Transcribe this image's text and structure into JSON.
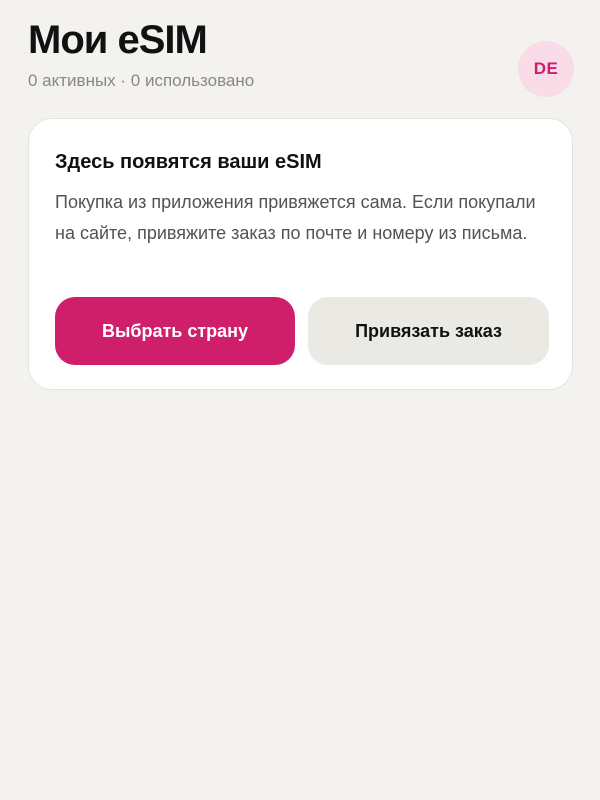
{
  "header": {
    "title": "Мои eSIM",
    "subtitle": "0 активных · 0 использовано",
    "avatar_initials": "DE"
  },
  "empty_card": {
    "title": "Здесь появятся ваши eSIM",
    "text": "Покупка из приложения привяжется сама. Если покупали на сайте, привяжите заказ по почте и номеру из письма.",
    "primary_button": "Выбрать страну",
    "secondary_button": "Привязать заказ"
  },
  "colors": {
    "background": "#f3f2ee",
    "accent": "#cf1f6b",
    "avatar_background": "#f9dce8",
    "secondary_button": "#ebe9e3"
  }
}
